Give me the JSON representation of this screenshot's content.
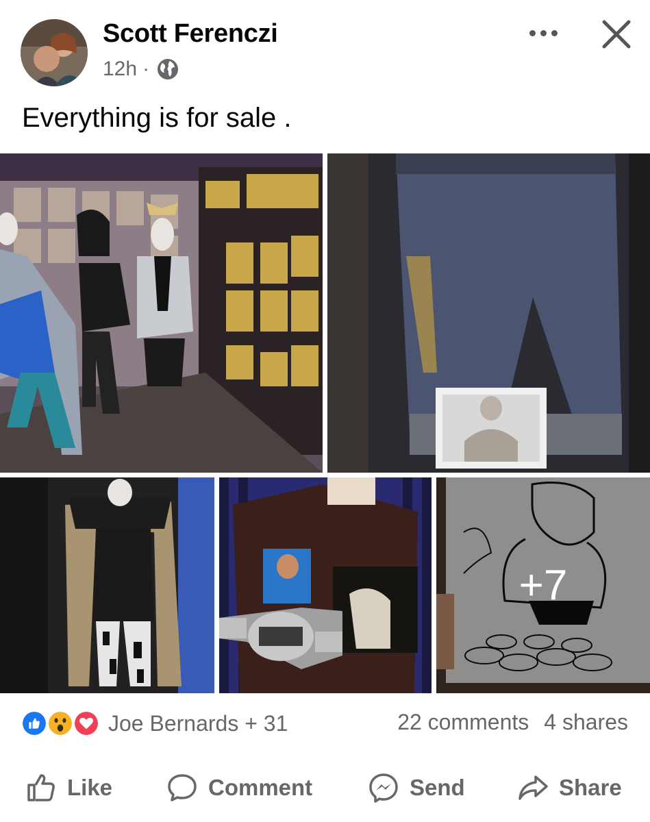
{
  "post": {
    "author": "Scott Ferenczi",
    "time": "12h",
    "separator": "·",
    "audience_icon": "globe-icon",
    "text": "Everything is for sale ."
  },
  "photos": {
    "more_count": "+7"
  },
  "engagement": {
    "reaction_icons": [
      "like-reaction-icon",
      "wow-reaction-icon",
      "love-reaction-icon"
    ],
    "reactors": "Joe Bernards + 31",
    "comments": "22 comments",
    "shares": "4 shares"
  },
  "actions": {
    "like": "Like",
    "comment": "Comment",
    "send": "Send",
    "share": "Share"
  },
  "colors": {
    "secondary_text": "#65676b",
    "like_blue": "#1877f2",
    "love_red": "#f33e58",
    "wow_yellow": "#f7b125"
  }
}
